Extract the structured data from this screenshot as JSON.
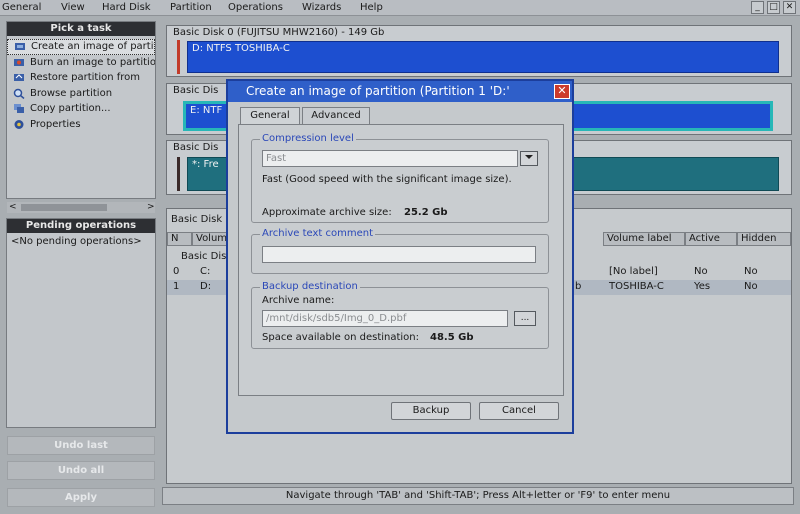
{
  "menu": {
    "items": [
      "General",
      "View",
      "Hard Disk",
      "Partition",
      "Operations",
      "Wizards",
      "Help"
    ]
  },
  "window_buttons": [
    "_",
    "□",
    "✕"
  ],
  "tasks_panel": {
    "title": "Pick a task",
    "items": [
      {
        "label": "Create an image of partition",
        "icon": "disk-image-icon"
      },
      {
        "label": "Burn an image to partition",
        "icon": "burn-icon"
      },
      {
        "label": "Restore partition from",
        "icon": "restore-icon"
      },
      {
        "label": "Browse partition",
        "icon": "browse-icon"
      },
      {
        "label": "Copy partition...",
        "icon": "copy-icon"
      },
      {
        "label": "Properties",
        "icon": "properties-icon"
      }
    ]
  },
  "pending_panel": {
    "title": "Pending operations",
    "empty_text": "<No pending operations>"
  },
  "left_buttons": {
    "undo_last": "Undo last",
    "undo_all": "Undo all",
    "apply": "Apply"
  },
  "disks": [
    {
      "title": "Basic Disk 0 (FUJITSU MHW2160) - 149 Gb",
      "partition": "D: NTFS TOSHIBA-C"
    },
    {
      "title": "Basic Dis",
      "partition": "E: NTF"
    },
    {
      "title": "Basic Dis",
      "partition": "*: Fre"
    }
  ],
  "table": {
    "tab_label": "Basic Disk",
    "columns": [
      "N",
      "Volume",
      "Volume label",
      "Active",
      "Hidden"
    ],
    "group_label": "Basic Dis",
    "rows": [
      {
        "n": "0",
        "volume": "C:",
        "extra": "",
        "label": "[No label]",
        "active": "No",
        "hidden": "No"
      },
      {
        "n": "1",
        "volume": "D:",
        "extra": "b",
        "label": "TOSHIBA-C",
        "active": "Yes",
        "hidden": "No"
      }
    ]
  },
  "status_bar": "Navigate through 'TAB' and 'Shift-TAB'; Press Alt+letter or 'F9' to enter menu",
  "dialog": {
    "title": "Create an image of partition (Partition 1 'D:'",
    "close": "✕",
    "tabs": [
      "General",
      "Advanced"
    ],
    "compression": {
      "legend": "Compression level",
      "value": "Fast",
      "description": "Fast (Good speed with the significant image size).",
      "archive_size_label": "Approximate archive size:",
      "archive_size_value": "25.2 Gb"
    },
    "comment": {
      "legend": "Archive text comment",
      "value": ""
    },
    "destination": {
      "legend": "Backup destination",
      "name_label": "Archive name:",
      "path": "/mnt/disk/sdb5/Img_0_D.pbf",
      "browse": "...",
      "space_label": "Space available on destination:",
      "space_value": "48.5 Gb"
    },
    "buttons": {
      "backup": "Backup",
      "cancel": "Cancel"
    }
  },
  "colors": {
    "titlebar": "#2f5fc9",
    "partition_blue": "#1d4fd0",
    "partition_teal": "#1f6f7e",
    "selected_row": "#b0b8c2"
  }
}
